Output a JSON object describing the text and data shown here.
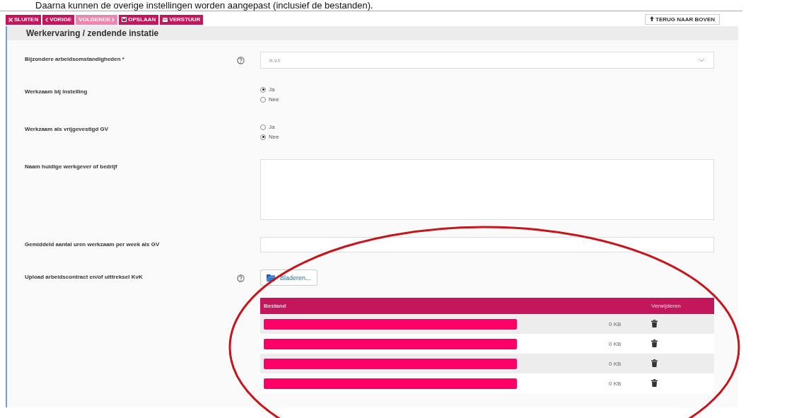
{
  "caption": "Daarna kunnen de overige instellingen worden aangepast (inclusief de bestanden).",
  "toolbar": [
    {
      "label": "SLUITEN",
      "disabled": false
    },
    {
      "label": "VORIGE",
      "disabled": false
    },
    {
      "label": "VOLGENDE",
      "disabled": true
    },
    {
      "label": "OPSLAAN",
      "disabled": false
    },
    {
      "label": "VERSTUUR",
      "disabled": false
    }
  ],
  "back_to_top": "TERUG NAAR BOVEN",
  "section_title": "Werkervaring / zendende instatie",
  "fields": [
    {
      "kind": "select",
      "label": "Bijzondere arbeidsomstandigheden *",
      "help": true,
      "value": "n.v.t."
    },
    {
      "kind": "radio",
      "label": "Werkzaam bij instelling",
      "help": false,
      "options": [
        {
          "label": "Ja",
          "selected": true
        },
        {
          "label": "Nee",
          "selected": false
        }
      ]
    },
    {
      "kind": "radio",
      "label": "Werkzaam als vrijgevestigd GV",
      "help": false,
      "options": [
        {
          "label": "Ja",
          "selected": false
        },
        {
          "label": "Nee",
          "selected": true
        }
      ]
    },
    {
      "kind": "textarea",
      "label": "Naam huidige werkgever of bedrijf",
      "help": false
    },
    {
      "kind": "text",
      "label": "Gemiddeld aantal uren werkzaam per week als GV",
      "help": false
    },
    {
      "kind": "upload",
      "label": "Upload arbeidscontract en/of uittreksel KvK",
      "help": true,
      "button": "Bladeren..."
    }
  ],
  "file_table": {
    "columns": [
      "Bestand",
      "Verwijderen"
    ],
    "rows": [
      {
        "size": "0 KB"
      },
      {
        "size": "0 KB"
      },
      {
        "size": "0 KB"
      },
      {
        "size": "0 KB"
      }
    ]
  }
}
